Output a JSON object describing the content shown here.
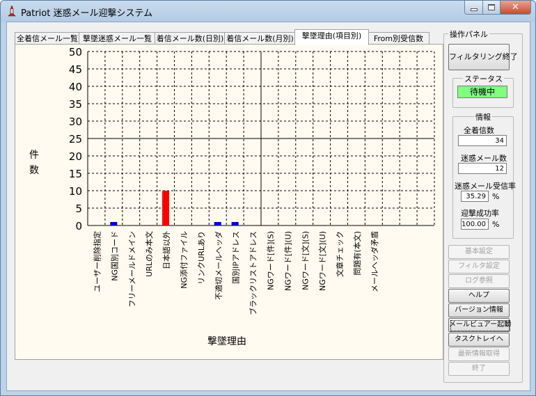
{
  "window": {
    "title": "Patriot 迷惑メール迎撃システム"
  },
  "tabs": [
    {
      "label": "全着信メール一覧",
      "active": false
    },
    {
      "label": "撃墜迷惑メール一覧",
      "active": false
    },
    {
      "label": "着信メール数(日別)",
      "active": false
    },
    {
      "label": "着信メール数(月別)",
      "active": false
    },
    {
      "label": "撃墜理由(項目別)",
      "active": true
    },
    {
      "label": "From別受信数",
      "active": false
    }
  ],
  "chart_data": {
    "type": "bar",
    "ylabel": "件数",
    "xlabel": "撃墜理由",
    "ylim": [
      0,
      50
    ],
    "yticks": [
      "0",
      "5",
      "10",
      "15",
      "20",
      "25",
      "30",
      "35",
      "40",
      "45",
      "50"
    ],
    "categories": [
      "ユーザー削除指定",
      "NG国別コード",
      "フリーメールドメイン",
      "URLのみ本文",
      "日本語以外",
      "NG添付ファイル",
      "リンクURLあり",
      "不適切メールヘッダ",
      "国別IPアドレス",
      "ブラックリストアドレス",
      "NGワード[件](S)",
      "NGワード[件](U)",
      "NGワード[文](S)",
      "NGワード[文](U)",
      "文章チェック",
      "問題有(本文)",
      "メールヘッダ矛盾"
    ],
    "values": [
      0,
      1,
      0,
      0,
      10,
      0,
      0,
      1,
      1,
      0,
      0,
      0,
      0,
      0,
      0,
      0,
      0
    ],
    "colors": [
      "#0000cc",
      "#0000cc",
      "#0000cc",
      "#0000cc",
      "#ff0000",
      "#0000cc",
      "#0000cc",
      "#0000cc",
      "#0000cc",
      "#0000cc",
      "#0000cc",
      "#0000cc",
      "#0000cc",
      "#0000cc",
      "#0000cc",
      "#0000cc",
      "#0000cc"
    ]
  },
  "panel": {
    "title": "操作パネル",
    "filter_button": "フィルタリング終了",
    "status_group": "ステータス",
    "status_value": "待機中",
    "info_group": "情報",
    "total_label": "全着信数",
    "total_value": "34",
    "spam_label": "迷惑メール数",
    "spam_value": "12",
    "rate_label": "迷惑メール受信率",
    "rate_value": "35.29",
    "rate_unit": "%",
    "success_label": "迎撃成功率",
    "success_value": "100.00",
    "success_unit": "%"
  },
  "buttons": [
    {
      "label": "基本設定",
      "enabled": false
    },
    {
      "label": "フィルタ設定",
      "enabled": false
    },
    {
      "label": "ログ参照",
      "enabled": false
    },
    {
      "label": "ヘルプ",
      "enabled": true
    },
    {
      "label": "バージョン情報",
      "enabled": true
    },
    {
      "label": "メールビュアー起動",
      "enabled": true,
      "focused": true
    },
    {
      "label": "タスクトレイへ",
      "enabled": true
    },
    {
      "label": "最新情報取得",
      "enabled": false
    },
    {
      "label": "終了",
      "enabled": false
    }
  ],
  "colors": {
    "status_bg": "#80ff80",
    "chart_bg": "#fffbf0",
    "bar_red": "#ff0000",
    "bar_blue": "#0000cc"
  }
}
